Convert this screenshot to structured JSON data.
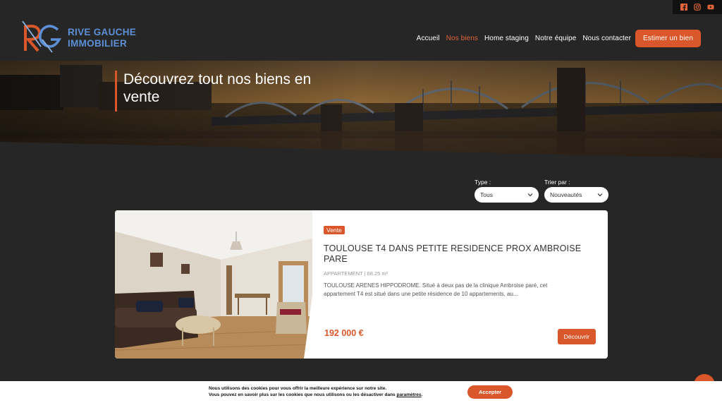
{
  "brand": {
    "name_line1": "RIVE GAUCHE",
    "name_line2": "IMMOBILIER",
    "logo_icon": "rg-monogram-logo",
    "accent": "#d9572a",
    "secondary": "#5d8fd6"
  },
  "social": [
    {
      "name": "facebook-icon"
    },
    {
      "name": "instagram-icon"
    },
    {
      "name": "youtube-icon"
    }
  ],
  "nav": {
    "items": [
      {
        "label": "Accueil",
        "active": false
      },
      {
        "label": "Nos biens",
        "active": true
      },
      {
        "label": "Home staging",
        "active": false
      },
      {
        "label": "Notre équipe",
        "active": false
      },
      {
        "label": "Nous contacter",
        "active": false
      }
    ],
    "cta": "Estimer un bien"
  },
  "hero": {
    "title": "Découvrez tout nos biens en vente"
  },
  "filters": {
    "type": {
      "label": "Type :",
      "value": "Tous"
    },
    "sort": {
      "label": "Trier par :",
      "value": "Nouveautés"
    }
  },
  "listing": {
    "badge": "Vente",
    "title": "TOULOUSE T4 DANS PETITE RESIDENCE PROX AMBROISE PARE",
    "meta": "APPARTEMENT | 68.25 m²",
    "description": "TOULOUSE ARENES HIPPODROME. Situé à deux pas de la clinique Ambroise paré, cet appartement T4 est situé dans une petite résidence de 10 appartements, au...",
    "price": "192 000 €",
    "button": "Découvrir"
  },
  "cookie": {
    "line1": "Nous utilisons des cookies pour vous offrir la meilleure expérience sur notre site.",
    "line2_prefix": "Vous pouvez en savoir plus sur les cookies que nous utilisons ou les désactiver dans ",
    "line2_link": "paramètres",
    "line2_suffix": ".",
    "accept": "Accepter"
  }
}
